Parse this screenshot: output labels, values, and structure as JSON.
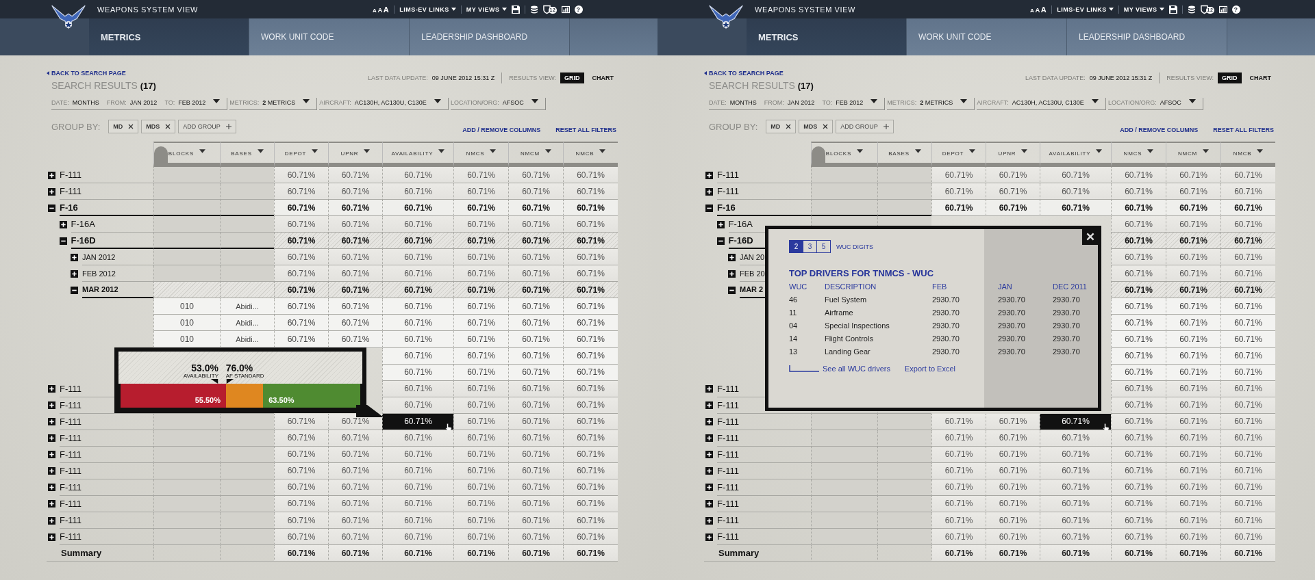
{
  "panels": [
    {
      "header": {
        "title": "WEAPONS SYSTEM VIEW",
        "font_sizes": [
          "A",
          "A",
          "A"
        ],
        "links": [
          "LIMS-EV LINKS",
          "MY VIEWS"
        ],
        "alert_count": "12",
        "help": "?"
      },
      "tabs": [
        {
          "label": "METRICS",
          "selected": true
        },
        {
          "label": "WORK UNIT CODE",
          "selected": false
        },
        {
          "label": "LEADERSHIP DASHBOARD",
          "selected": false
        }
      ],
      "back_link": "BACK TO SEARCH PAGE",
      "results": {
        "title": "SEARCH RESULTS",
        "count": "(17)"
      },
      "last_update": {
        "label": "LAST DATA UPDATE:",
        "value": "09 JUNE 2012 15:31 Z"
      },
      "results_view": {
        "label": "RESULTS VIEW:",
        "options": [
          {
            "label": "GRID",
            "selected": true
          },
          {
            "label": "CHART",
            "selected": false
          }
        ]
      },
      "filters": [
        {
          "parts": [
            {
              "label": "DATE:",
              "value": "MONTHS"
            },
            {
              "label": "FROM:",
              "value": "JAN 2012"
            },
            {
              "label": "TO:",
              "value": "FEB 2012"
            }
          ]
        },
        {
          "parts": [
            {
              "label": "METRICS:",
              "value": "**2** METRICS"
            }
          ]
        },
        {
          "parts": [
            {
              "label": "AIRCRAFT:",
              "value": "AC130H, AC130U, C130E"
            }
          ]
        },
        {
          "parts": [
            {
              "label": "LOCATION/ORG:",
              "value": "AFSOC"
            }
          ]
        }
      ],
      "group_by": {
        "label": "GROUP BY:",
        "chips": [
          "MD",
          "MDS"
        ],
        "add": "ADD GROUP"
      },
      "links": [
        "ADD / REMOVE COLUMNS",
        "RESET ALL FILTERS"
      ],
      "table": {
        "columns": [
          {
            "label": "BLOCKS",
            "kind": "blocks"
          },
          {
            "label": "BASES",
            "kind": "bases"
          },
          {
            "label": "DEPOT",
            "kind": "depot"
          },
          {
            "label": "UPNR",
            "kind": "upnr"
          },
          {
            "label": "AVAILABILITY",
            "kind": "availability"
          },
          {
            "label": "NMCS",
            "kind": "nmcs"
          },
          {
            "label": "NMCM",
            "kind": "nmcm"
          },
          {
            "label": "NMCB",
            "kind": "nmcb"
          }
        ],
        "rows": [
          {
            "kind": "group",
            "label": "F-111",
            "expanded": false,
            "selected": false,
            "cells": {
              "depot": "60.71%",
              "upnr": "60.71%",
              "availability": "60.71%",
              "nmcs": "60.71%",
              "nmcm": "60.71%",
              "nmcb": "60.71%"
            }
          },
          {
            "kind": "group",
            "label": "F-111",
            "expanded": false,
            "selected": false,
            "cells": {
              "depot": "60.71%",
              "upnr": "60.71%",
              "availability": "60.71%",
              "nmcs": "60.71%",
              "nmcm": "60.71%",
              "nmcb": "60.71%"
            }
          },
          {
            "kind": "group",
            "label": "F-16",
            "expanded": true,
            "selected": false,
            "cells": {
              "depot": "60.71%",
              "upnr": "60.71%",
              "availability": "60.71%",
              "nmcs": "60.71%",
              "nmcm": "60.71%",
              "nmcb": "60.71%"
            },
            "children": [
              {
                "kind": "group",
                "label": "F-16A",
                "expanded": false,
                "selected": false,
                "cells": {
                  "depot": "60.71%",
                  "upnr": "60.71%",
                  "availability": "60.71%",
                  "nmcs": "60.71%",
                  "nmcm": "60.71%",
                  "nmcb": "60.71%"
                }
              },
              {
                "kind": "group",
                "label": "F-16D",
                "expanded": true,
                "selected": true,
                "cells": {
                  "depot": "60.71%",
                  "upnr": "60.71%",
                  "availability": "60.71%",
                  "nmcs": "60.71%",
                  "nmcm": "60.71%",
                  "nmcb": "60.71%"
                },
                "children": [
                  {
                    "kind": "group",
                    "label": "JAN 2012",
                    "expanded": false,
                    "selected": false,
                    "cells": {
                      "depot": "60.71%",
                      "upnr": "60.71%",
                      "availability": "60.71%",
                      "nmcs": "60.71%",
                      "nmcm": "60.71%",
                      "nmcb": "60.71%"
                    }
                  },
                  {
                    "kind": "group",
                    "label": "FEB 2012",
                    "expanded": false,
                    "selected": false,
                    "cells": {
                      "depot": "60.71%",
                      "upnr": "60.71%",
                      "availability": "60.71%",
                      "nmcs": "60.71%",
                      "nmcm": "60.71%",
                      "nmcb": "60.71%"
                    }
                  },
                  {
                    "kind": "group",
                    "label": "MAR 2012",
                    "expanded": true,
                    "selected": true,
                    "cells": {
                      "depot": "60.71%",
                      "upnr": "60.71%",
                      "availability": "60.71%",
                      "nmcs": "60.71%",
                      "nmcm": "60.71%",
                      "nmcb": "60.71%"
                    },
                    "children": [
                      {
                        "kind": "leaf",
                        "cells": {
                          "blocks": "010",
                          "bases": "Abidi...",
                          "depot": "60.71%",
                          "upnr": "60.71%",
                          "availability": "60.71%",
                          "nmcs": "60.71%",
                          "nmcm": "60.71%",
                          "nmcb": "60.71%"
                        }
                      },
                      {
                        "kind": "leaf",
                        "cells": {
                          "blocks": "010",
                          "bases": "Abidi...",
                          "depot": "60.71%",
                          "upnr": "60.71%",
                          "availability": "60.71%",
                          "nmcs": "60.71%",
                          "nmcm": "60.71%",
                          "nmcb": "60.71%"
                        }
                      },
                      {
                        "kind": "leaf",
                        "cells": {
                          "blocks": "010",
                          "bases": "Abidi...",
                          "depot": "60.71%",
                          "upnr": "60.71%",
                          "availability": "60.71%",
                          "nmcs": "60.71%",
                          "nmcm": "60.71%",
                          "nmcb": "60.71%"
                        }
                      },
                      {
                        "kind": "leaf",
                        "cells": {
                          "availability": "60.71%",
                          "nmcs": "60.71%",
                          "nmcm": "60.71%",
                          "nmcb": "60.71%"
                        }
                      },
                      {
                        "kind": "leaf",
                        "cells": {
                          "availability": "60.71%",
                          "nmcs": "60.71%",
                          "nmcm": "60.71%",
                          "nmcb": "60.71%"
                        }
                      }
                    ]
                  }
                ]
              }
            ]
          },
          {
            "kind": "group",
            "label": "F-111",
            "expanded": false,
            "selected": false,
            "cells": {
              "availability": "60.71%",
              "nmcs": "60.71%",
              "nmcm": "60.71%",
              "nmcb": "60.71%"
            }
          },
          {
            "kind": "group",
            "label": "F-111",
            "expanded": false,
            "selected": false,
            "cells": {
              "availability": "60.71%",
              "nmcs": "60.71%",
              "nmcm": "60.71%",
              "nmcb": "60.71%"
            }
          },
          {
            "kind": "group",
            "label": "F-111",
            "expanded": false,
            "selected": false,
            "highlighted": {
              "availability": true
            },
            "cells": {
              "depot": "60.71%",
              "upnr": "60.71%",
              "availability": "60.71%",
              "nmcs": "60.71%",
              "nmcm": "60.71%",
              "nmcb": "60.71%"
            }
          },
          {
            "kind": "group",
            "label": "F-111",
            "expanded": false,
            "selected": false,
            "cells": {
              "depot": "60.71%",
              "upnr": "60.71%",
              "availability": "60.71%",
              "nmcs": "60.71%",
              "nmcm": "60.71%",
              "nmcb": "60.71%"
            }
          },
          {
            "kind": "group",
            "label": "F-111",
            "expanded": false,
            "selected": false,
            "cells": {
              "depot": "60.71%",
              "upnr": "60.71%",
              "availability": "60.71%",
              "nmcs": "60.71%",
              "nmcm": "60.71%",
              "nmcb": "60.71%"
            }
          },
          {
            "kind": "group",
            "label": "F-111",
            "expanded": false,
            "selected": false,
            "cells": {
              "depot": "60.71%",
              "upnr": "60.71%",
              "availability": "60.71%",
              "nmcs": "60.71%",
              "nmcm": "60.71%",
              "nmcb": "60.71%"
            }
          },
          {
            "kind": "group",
            "label": "F-111",
            "expanded": false,
            "selected": false,
            "cells": {
              "depot": "60.71%",
              "upnr": "60.71%",
              "availability": "60.71%",
              "nmcs": "60.71%",
              "nmcm": "60.71%",
              "nmcb": "60.71%"
            }
          },
          {
            "kind": "group",
            "label": "F-111",
            "expanded": false,
            "selected": false,
            "cells": {
              "depot": "60.71%",
              "upnr": "60.71%",
              "availability": "60.71%",
              "nmcs": "60.71%",
              "nmcm": "60.71%",
              "nmcb": "60.71%"
            }
          },
          {
            "kind": "group",
            "label": "F-111",
            "expanded": false,
            "selected": false,
            "cells": {
              "depot": "60.71%",
              "upnr": "60.71%",
              "availability": "60.71%",
              "nmcs": "60.71%",
              "nmcm": "60.71%",
              "nmcb": "60.71%"
            }
          },
          {
            "kind": "group",
            "label": "F-111",
            "expanded": false,
            "selected": false,
            "cells": {
              "depot": "60.71%",
              "upnr": "60.71%",
              "availability": "60.71%",
              "nmcs": "60.71%",
              "nmcm": "60.71%",
              "nmcb": "60.71%"
            }
          }
        ],
        "summary": {
          "label": "Summary",
          "cells": {
            "depot": "60.71%",
            "upnr": "60.71%",
            "availability": "60.71%",
            "nmcs": "60.71%",
            "nmcm": "60.71%",
            "nmcb": "60.71%"
          }
        }
      },
      "popup": {
        "kind": "gauge",
        "markers": [
          {
            "value": "53.0%",
            "label": "AVAILABILITY"
          },
          {
            "value": "76.0%",
            "label": "AF STANDARD"
          }
        ],
        "segments": [
          {
            "color": "#b71d2e",
            "level": 0.44,
            "text": "55.50%"
          },
          {
            "color": "#df8720"
          },
          {
            "color": "#4f8b31",
            "level": 0.405,
            "text": "63.50%"
          }
        ]
      }
    },
    {
      "header": {
        "title": "WEAPONS SYSTEM VIEW",
        "font_sizes": [
          "A",
          "A",
          "A"
        ],
        "links": [
          "LIMS-EV LINKS",
          "MY VIEWS"
        ],
        "alert_count": "12",
        "help": "?"
      },
      "tabs": [
        {
          "label": "METRICS",
          "selected": true
        },
        {
          "label": "WORK UNIT CODE",
          "selected": false
        },
        {
          "label": "LEADERSHIP DASHBOARD",
          "selected": false
        }
      ],
      "back_link": "BACK TO SEARCH PAGE",
      "results": {
        "title": "SEARCH RESULTS",
        "count": "(17)"
      },
      "last_update": {
        "label": "LAST DATA UPDATE:",
        "value": "09 JUNE 2012 15:31 Z"
      },
      "results_view": {
        "label": "RESULTS VIEW:",
        "options": [
          {
            "label": "GRID",
            "selected": true
          },
          {
            "label": "CHART",
            "selected": false
          }
        ]
      },
      "filters": [
        {
          "parts": [
            {
              "label": "DATE:",
              "value": "MONTHS"
            },
            {
              "label": "FROM:",
              "value": "JAN 2012"
            },
            {
              "label": "TO:",
              "value": "FEB 2012"
            }
          ]
        },
        {
          "parts": [
            {
              "label": "METRICS:",
              "value": "**2** METRICS"
            }
          ]
        },
        {
          "parts": [
            {
              "label": "AIRCRAFT:",
              "value": "AC130H, AC130U, C130E"
            }
          ]
        },
        {
          "parts": [
            {
              "label": "LOCATION/ORG:",
              "value": "AFSOC"
            }
          ]
        }
      ],
      "group_by": {
        "label": "GROUP BY:",
        "chips": [
          "MD",
          "MDS"
        ],
        "add": "ADD GROUP"
      },
      "links": [
        "ADD / REMOVE COLUMNS",
        "RESET ALL FILTERS"
      ],
      "table": {
        "columns": [
          {
            "label": "BLOCKS",
            "kind": "blocks"
          },
          {
            "label": "BASES",
            "kind": "bases"
          },
          {
            "label": "DEPOT",
            "kind": "depot"
          },
          {
            "label": "UPNR",
            "kind": "upnr"
          },
          {
            "label": "AVAILABILITY",
            "kind": "availability"
          },
          {
            "label": "NMCS",
            "kind": "nmcs"
          },
          {
            "label": "NMCM",
            "kind": "nmcm"
          },
          {
            "label": "NMCB",
            "kind": "nmcb"
          }
        ],
        "rows": [
          {
            "kind": "group",
            "label": "F-111",
            "expanded": false,
            "selected": false,
            "cells": {
              "depot": "60.71%",
              "upnr": "60.71%",
              "availability": "60.71%",
              "nmcs": "60.71%",
              "nmcm": "60.71%",
              "nmcb": "60.71%"
            }
          },
          {
            "kind": "group",
            "label": "F-111",
            "expanded": false,
            "selected": false,
            "cells": {
              "depot": "60.71%",
              "upnr": "60.71%",
              "availability": "60.71%",
              "nmcs": "60.71%",
              "nmcm": "60.71%",
              "nmcb": "60.71%"
            }
          },
          {
            "kind": "group",
            "label": "F-16",
            "expanded": true,
            "selected": false,
            "cells": {
              "depot": "60.71%",
              "upnr": "60.71%",
              "availability": "60.71%",
              "nmcs": "60.71%",
              "nmcm": "60.71%",
              "nmcb": "60.71%"
            },
            "children": [
              {
                "kind": "group",
                "label": "F-16A",
                "expanded": false,
                "selected": false,
                "cells": {
                  "nmcs": "60.71%",
                  "nmcm": "60.71%",
                  "nmcb": "60.71%"
                }
              },
              {
                "kind": "group",
                "label": "F-16D",
                "expanded": true,
                "selected": true,
                "cells": {
                  "nmcs": "60.71%",
                  "nmcm": "60.71%",
                  "nmcb": "60.71%"
                },
                "children": [
                  {
                    "kind": "group",
                    "label": "JAN 20",
                    "expanded": false,
                    "selected": false,
                    "cells": {
                      "nmcs": "60.71%",
                      "nmcm": "60.71%",
                      "nmcb": "60.71%"
                    }
                  },
                  {
                    "kind": "group",
                    "label": "FEB 20",
                    "expanded": false,
                    "selected": false,
                    "cells": {
                      "nmcs": "60.71%",
                      "nmcm": "60.71%",
                      "nmcb": "60.71%"
                    }
                  },
                  {
                    "kind": "group",
                    "label": "MAR 2",
                    "expanded": true,
                    "selected": true,
                    "cells": {
                      "nmcs": "60.71%",
                      "nmcm": "60.71%",
                      "nmcb": "60.71%"
                    },
                    "children": [
                      {
                        "kind": "leaf",
                        "cells": {
                          "nmcs": "60.71%",
                          "nmcm": "60.71%",
                          "nmcb": "60.71%"
                        }
                      },
                      {
                        "kind": "leaf",
                        "cells": {
                          "nmcs": "60.71%",
                          "nmcm": "60.71%",
                          "nmcb": "60.71%"
                        }
                      },
                      {
                        "kind": "leaf",
                        "cells": {
                          "nmcs": "60.71%",
                          "nmcm": "60.71%",
                          "nmcb": "60.71%"
                        }
                      },
                      {
                        "kind": "leaf",
                        "cells": {
                          "nmcs": "60.71%",
                          "nmcm": "60.71%",
                          "nmcb": "60.71%"
                        }
                      },
                      {
                        "kind": "leaf",
                        "cells": {
                          "nmcs": "60.71%",
                          "nmcm": "60.71%",
                          "nmcb": "60.71%"
                        }
                      }
                    ]
                  }
                ]
              }
            ]
          },
          {
            "kind": "group",
            "label": "F-111",
            "expanded": false,
            "selected": false,
            "cells": {
              "nmcs": "60.71%",
              "nmcm": "60.71%",
              "nmcb": "60.71%"
            }
          },
          {
            "kind": "group",
            "label": "F-111",
            "expanded": false,
            "selected": false,
            "cells": {
              "nmcs": "60.71%",
              "nmcm": "60.71%",
              "nmcb": "60.71%"
            }
          },
          {
            "kind": "group",
            "label": "F-111",
            "expanded": false,
            "selected": false,
            "highlighted": {
              "availability": true
            },
            "cells": {
              "depot": "60.71%",
              "upnr": "60.71%",
              "availability": "60.71%",
              "nmcs": "60.71%",
              "nmcm": "60.71%",
              "nmcb": "60.71%"
            }
          },
          {
            "kind": "group",
            "label": "F-111",
            "expanded": false,
            "selected": false,
            "cells": {
              "depot": "60.71%",
              "upnr": "60.71%",
              "availability": "60.71%",
              "nmcs": "60.71%",
              "nmcm": "60.71%",
              "nmcb": "60.71%"
            }
          },
          {
            "kind": "group",
            "label": "F-111",
            "expanded": false,
            "selected": false,
            "cells": {
              "depot": "60.71%",
              "upnr": "60.71%",
              "availability": "60.71%",
              "nmcs": "60.71%",
              "nmcm": "60.71%",
              "nmcb": "60.71%"
            }
          },
          {
            "kind": "group",
            "label": "F-111",
            "expanded": false,
            "selected": false,
            "cells": {
              "depot": "60.71%",
              "upnr": "60.71%",
              "availability": "60.71%",
              "nmcs": "60.71%",
              "nmcm": "60.71%",
              "nmcb": "60.71%"
            }
          },
          {
            "kind": "group",
            "label": "F-111",
            "expanded": false,
            "selected": false,
            "cells": {
              "depot": "60.71%",
              "upnr": "60.71%",
              "availability": "60.71%",
              "nmcs": "60.71%",
              "nmcm": "60.71%",
              "nmcb": "60.71%"
            }
          },
          {
            "kind": "group",
            "label": "F-111",
            "expanded": false,
            "selected": false,
            "cells": {
              "depot": "60.71%",
              "upnr": "60.71%",
              "availability": "60.71%",
              "nmcs": "60.71%",
              "nmcm": "60.71%",
              "nmcb": "60.71%"
            }
          },
          {
            "kind": "group",
            "label": "F-111",
            "expanded": false,
            "selected": false,
            "cells": {
              "depot": "60.71%",
              "upnr": "60.71%",
              "availability": "60.71%",
              "nmcs": "60.71%",
              "nmcm": "60.71%",
              "nmcb": "60.71%"
            }
          },
          {
            "kind": "group",
            "label": "F-111",
            "expanded": false,
            "selected": false,
            "cells": {
              "depot": "60.71%",
              "upnr": "60.71%",
              "availability": "60.71%",
              "nmcs": "60.71%",
              "nmcm": "60.71%",
              "nmcb": "60.71%"
            }
          }
        ],
        "summary": {
          "label": "Summary",
          "cells": {
            "depot": "60.71%",
            "upnr": "60.71%",
            "availability": "60.71%",
            "nmcs": "60.71%",
            "nmcm": "60.71%",
            "nmcb": "60.71%"
          }
        }
      },
      "popup": {
        "kind": "wuc",
        "digits": [
          {
            "label": "2",
            "selected": true
          },
          {
            "label": "3",
            "selected": false
          },
          {
            "label": "5",
            "selected": false
          }
        ],
        "digits_label": "WUC DIGITS",
        "title": "TOP DRIVERS FOR TNMCS - WUC",
        "columns": [
          "WUC",
          "DESCRIPTION",
          "FEB",
          "JAN",
          "DEC 2011"
        ],
        "rows": [
          [
            "46",
            "Fuel System",
            "2930.70",
            "2930.70",
            "2930.70"
          ],
          [
            "11",
            "Airframe",
            "2930.70",
            "2930.70",
            "2930.70"
          ],
          [
            "04",
            "Special Inspections",
            "2930.70",
            "2930.70",
            "2930.70"
          ],
          [
            "14",
            "Flight Controls",
            "2930.70",
            "2930.70",
            "2930.70"
          ],
          [
            "13",
            "Landing Gear",
            "2930.70",
            "2930.70",
            "2930.70"
          ]
        ],
        "links": [
          "See all WUC drivers",
          "Export to Excel"
        ]
      }
    }
  ]
}
